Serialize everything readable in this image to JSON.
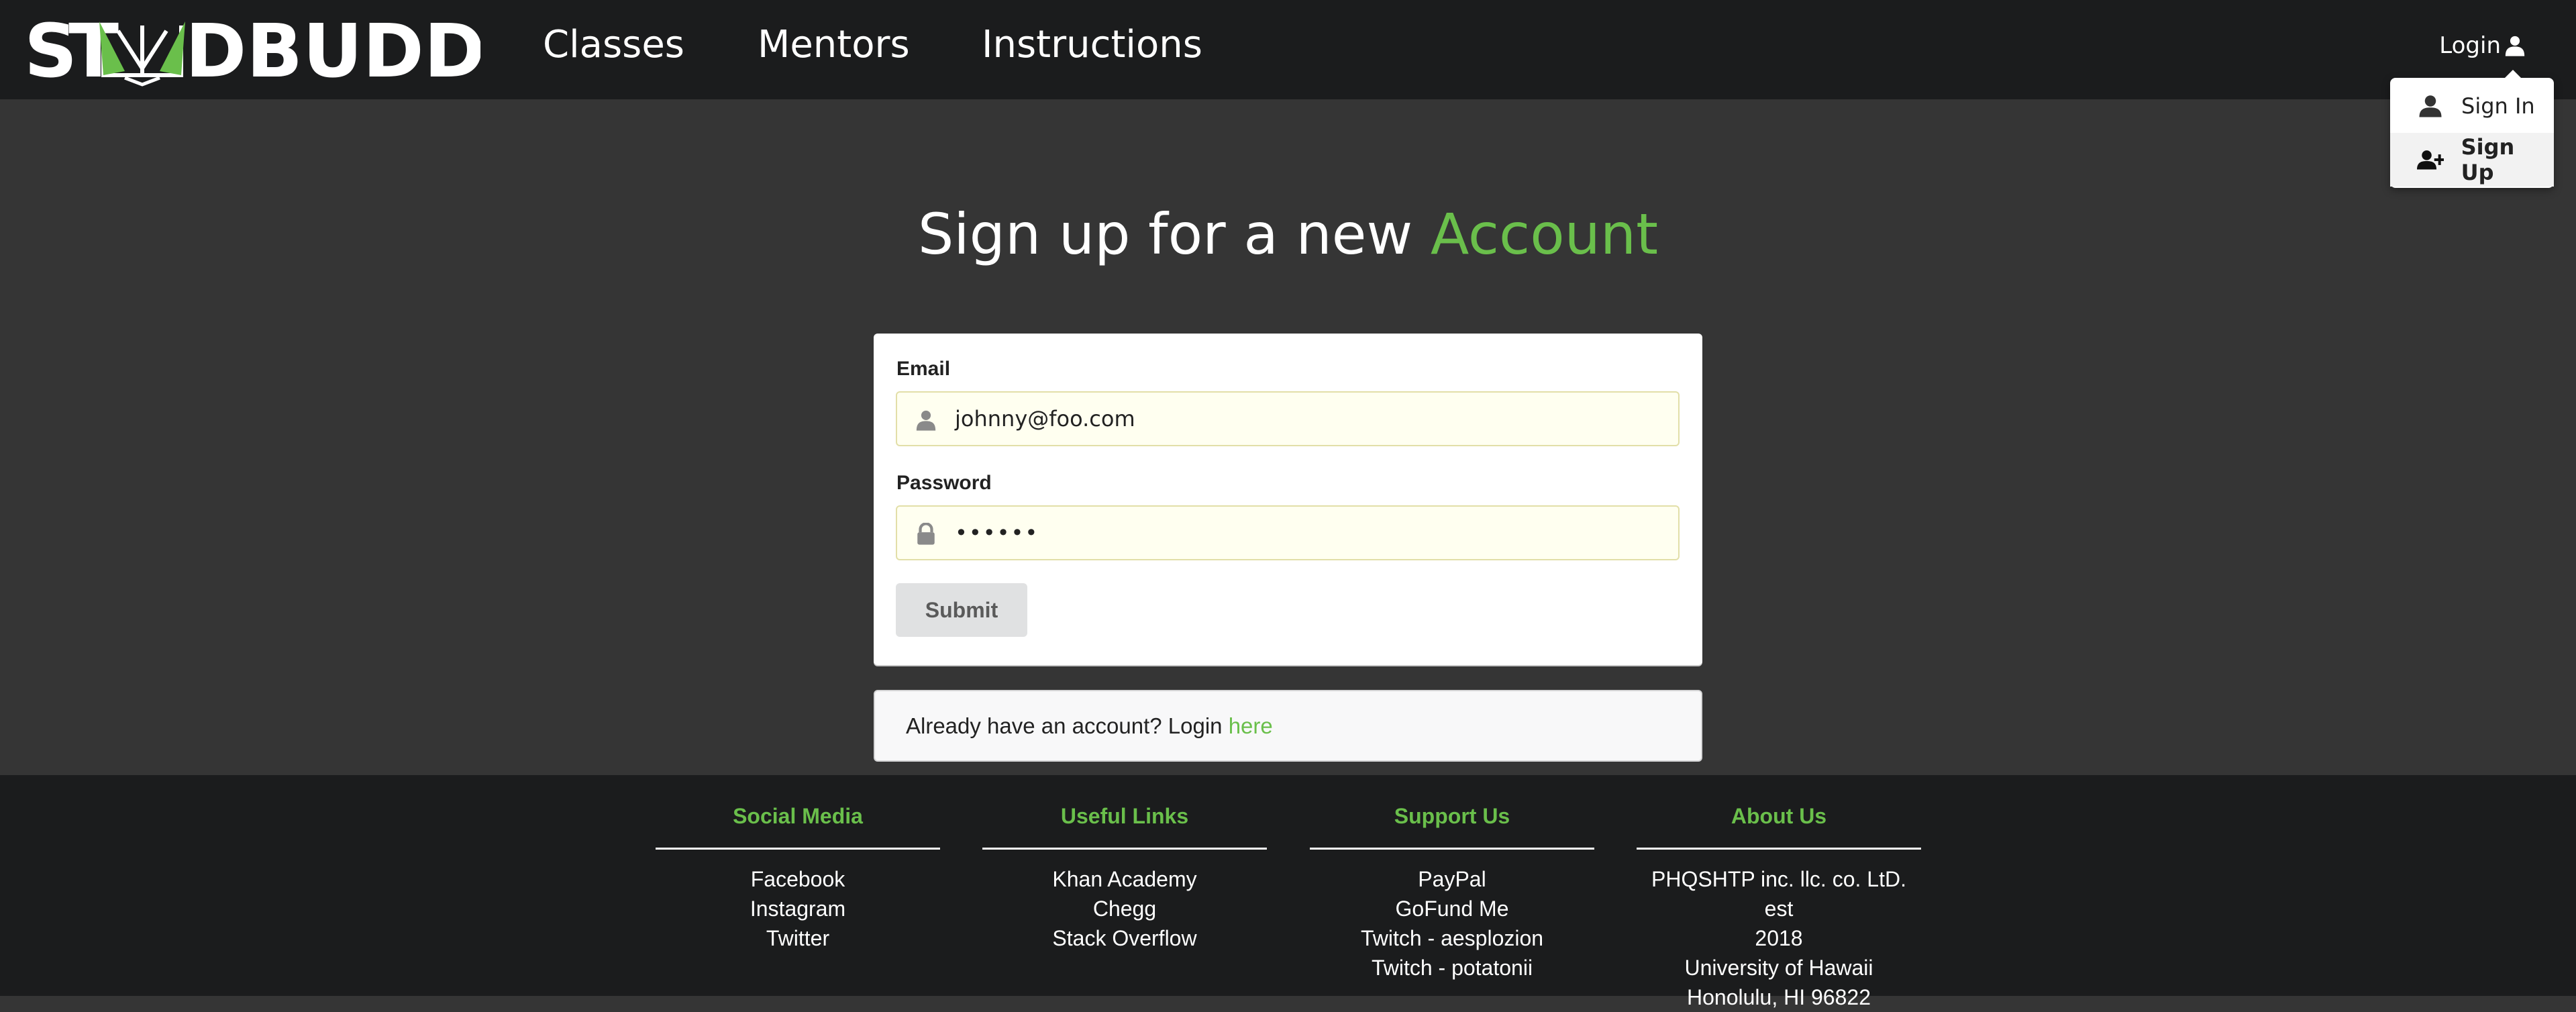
{
  "brand": {
    "name": "STUDBUDD",
    "accent_color": "#6abf4b"
  },
  "nav": {
    "items": [
      {
        "label": "Classes"
      },
      {
        "label": "Mentors"
      },
      {
        "label": "Instructions"
      }
    ],
    "login_label": "Login"
  },
  "dropdown": {
    "items": [
      {
        "label": "Sign In",
        "icon": "user-icon"
      },
      {
        "label": "Sign Up",
        "icon": "add-user-icon"
      }
    ]
  },
  "page": {
    "title_prefix": "Sign up for a new ",
    "title_accent": "Account"
  },
  "form": {
    "email_label": "Email",
    "email_value": "johnny@foo.com",
    "password_label": "Password",
    "password_value": "••••••",
    "submit_label": "Submit"
  },
  "message": {
    "text": "Already have an account? Login ",
    "link": "here"
  },
  "footer": {
    "columns": [
      {
        "title": "Social Media",
        "links": [
          "Facebook",
          "Instagram",
          "Twitter"
        ]
      },
      {
        "title": "Useful Links",
        "links": [
          "Khan Academy",
          "Chegg",
          "Stack Overflow"
        ]
      },
      {
        "title": "Support Us",
        "links": [
          "PayPal",
          "GoFund Me",
          "Twitch - aesplozion",
          "Twitch - potatonii"
        ]
      },
      {
        "title": "About Us",
        "links": [
          "PHQSHTP inc. llc. co. LtD. est",
          "2018",
          "University of Hawaii",
          "Honolulu, HI 96822"
        ]
      }
    ]
  }
}
